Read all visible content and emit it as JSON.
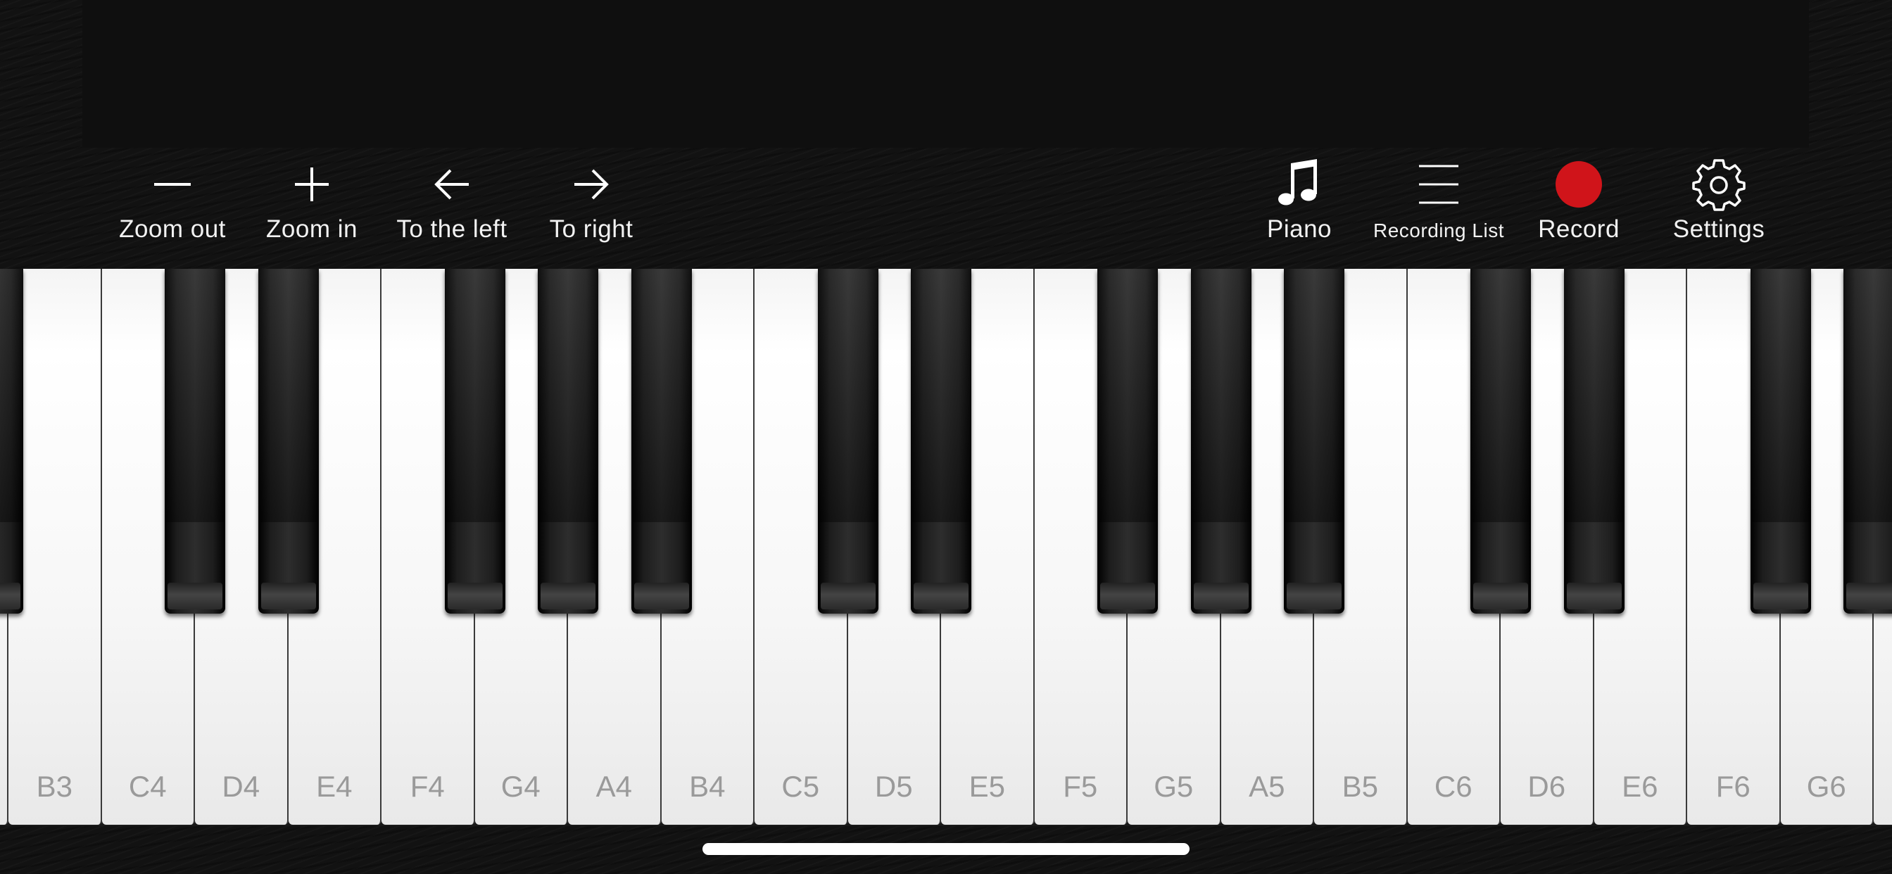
{
  "toolbar": {
    "left": [
      {
        "id": "zoom-out",
        "label": "Zoom out",
        "icon": "minus-icon"
      },
      {
        "id": "zoom-in",
        "label": "Zoom in",
        "icon": "plus-icon"
      },
      {
        "id": "to-left",
        "label": "To the left",
        "icon": "arrow-left-icon"
      },
      {
        "id": "to-right",
        "label": "To right",
        "icon": "arrow-right-icon"
      }
    ],
    "right": [
      {
        "id": "piano",
        "label": "Piano",
        "icon": "music-note-icon"
      },
      {
        "id": "recording-list",
        "label": "Recording List",
        "icon": "list-icon"
      },
      {
        "id": "record",
        "label": "Record",
        "icon": "record-dot-icon"
      },
      {
        "id": "settings",
        "label": "Settings",
        "icon": "gear-icon"
      }
    ]
  },
  "colors": {
    "background": "#121212",
    "record_red": "#d0141a",
    "note_label": "#9a9a9a"
  },
  "keyboard": {
    "white_keys": [
      "B3",
      "C4",
      "D4",
      "E4",
      "F4",
      "G4",
      "A4",
      "B4",
      "C5",
      "D5",
      "E5",
      "F5",
      "G5",
      "A5",
      "B5",
      "C6",
      "D6",
      "E6",
      "F6",
      "G6"
    ]
  }
}
